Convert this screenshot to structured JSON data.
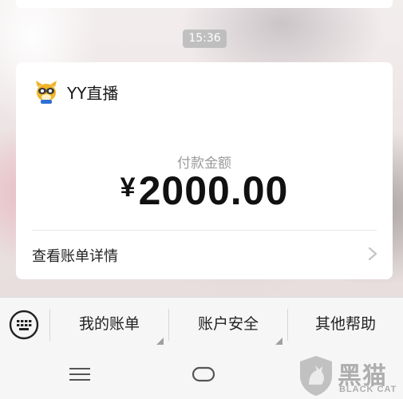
{
  "chat": {
    "timestamp": "15:36"
  },
  "payment_card": {
    "app_icon": "yy-bear-logo-icon",
    "app_name": "YY直播",
    "amount_label": "付款金额",
    "currency_symbol": "¥",
    "amount": "2000.00",
    "details_link": "查看账单详情",
    "details_icon": "chevron-right-icon"
  },
  "menu": {
    "keyboard_icon": "keyboard-icon",
    "items": [
      {
        "label": "我的账单"
      },
      {
        "label": "账户安全"
      },
      {
        "label": "其他帮助"
      }
    ]
  },
  "nav": {
    "menu_icon": "hamburger-menu-icon",
    "home_icon": "home-pill-icon"
  },
  "watermark": {
    "icon": "black-cat-shield-icon",
    "text_cn": "黑猫",
    "text_en": "BLACK CAT"
  },
  "colors": {
    "card_background": "#ffffff",
    "timestamp_background": "#b9b9b9",
    "menu_background": "#f6f6f6"
  }
}
